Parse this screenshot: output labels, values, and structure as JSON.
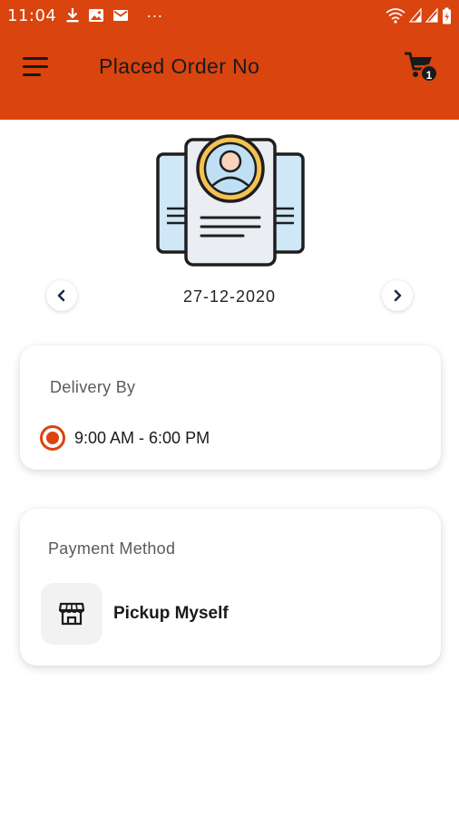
{
  "status_bar": {
    "time": "11:04",
    "overflow": "···",
    "icons": [
      "download-icon",
      "image-icon",
      "mail-icon",
      "wifi-icon",
      "signal-icon",
      "signal-icon",
      "battery-icon"
    ]
  },
  "app_bar": {
    "title": "Placed Order No",
    "cart_count": "1"
  },
  "date_selector": {
    "date": "27-12-2020"
  },
  "delivery": {
    "title": "Delivery By",
    "option_label": "9:00 AM - 6:00 PM",
    "selected": true
  },
  "payment": {
    "title": "Payment Method",
    "option_label": "Pickup Myself",
    "option_icon": "store-icon"
  },
  "colors": {
    "brand": "#d9440f",
    "dark": "#1a1a1a",
    "card_bg": "#ffffff",
    "icon_bg": "#f2f2f2"
  }
}
